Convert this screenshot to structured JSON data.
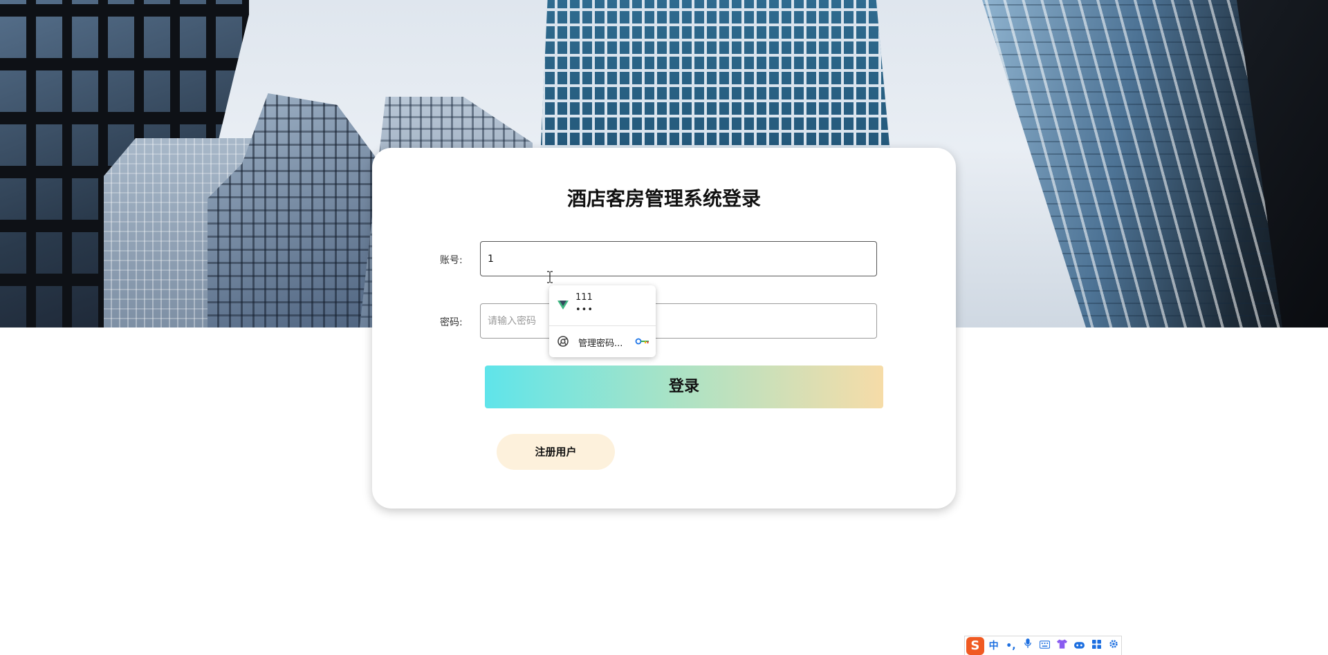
{
  "login": {
    "title": "酒店客房管理系统登录",
    "username_label": "账号:",
    "username_value": "1",
    "password_label": "密码:",
    "password_placeholder": "请输入密码",
    "login_label": "登录",
    "register_label": "注册用户"
  },
  "autofill": {
    "saved_username": "111",
    "saved_password_mask": "•••",
    "manage_label": "管理密码..."
  },
  "ime": {
    "logo": "S",
    "mode": "中",
    "punct": "•,"
  },
  "colors": {
    "login_gradient": [
      "#5fe4ea",
      "#a6e3c7",
      "#f6dca8"
    ],
    "register_bg": "#fdf1dc",
    "ime_accent": "#1d6fe0",
    "ime_logo": "#f05a22"
  }
}
